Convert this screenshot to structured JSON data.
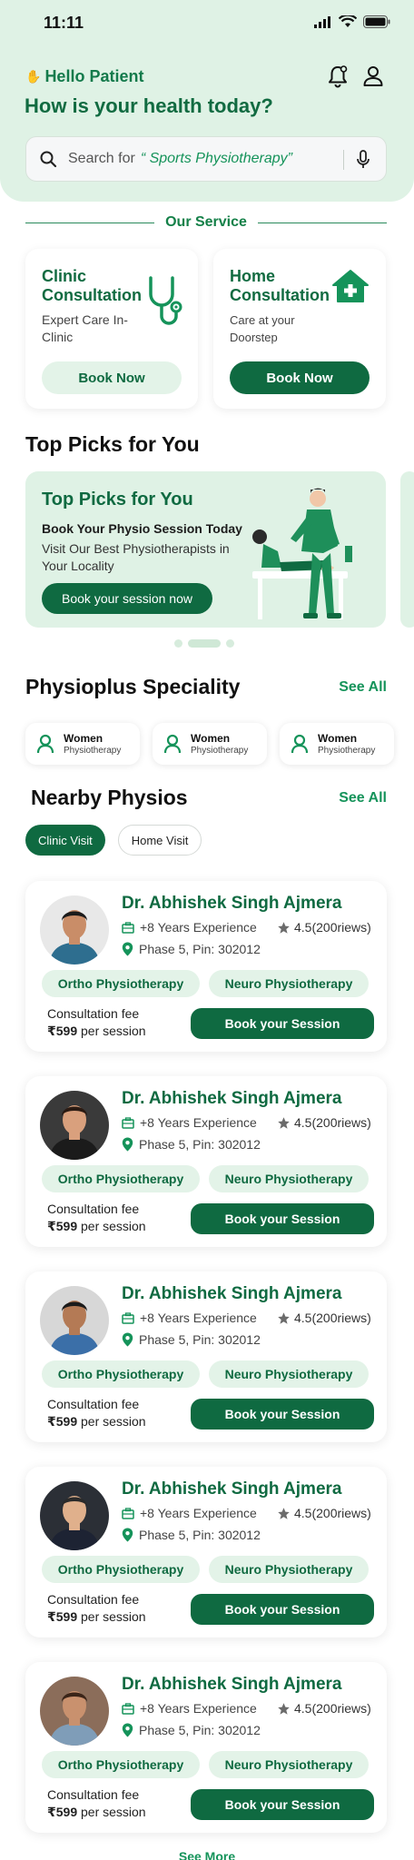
{
  "status_bar": {
    "time": "11:11"
  },
  "header": {
    "greeting": "Hello Patient",
    "subtitle": "How is your health today?",
    "search_prefix": "Search for",
    "search_highlight": "“ Sports Physiotherapy”"
  },
  "service": {
    "section_label": "Our Service",
    "cards": [
      {
        "title": "Clinic Consultation",
        "desc": "Expert Care In-Clinic",
        "button": "Book Now"
      },
      {
        "title": "Home Consultation",
        "desc": "Care at your Doorstep",
        "button": "Book Now"
      }
    ]
  },
  "top_picks": {
    "title": "Top Picks for You",
    "banner_title": "Top Picks for You",
    "banner_line1": "Book Your Physio Session Today",
    "banner_line2": "Visit Our Best Physiotherapists in Your Locality",
    "banner_button": "Book your session now",
    "carousel_active_index": 1
  },
  "speciality": {
    "title": "Physioplus Speciality",
    "see_all": "See All",
    "chips": [
      {
        "title": "Women",
        "sub": "Physiotherapy"
      },
      {
        "title": "Women",
        "sub": "Physiotherapy"
      },
      {
        "title": "Women",
        "sub": "Physiotherapy"
      }
    ]
  },
  "nearby": {
    "title": "Nearby Physios",
    "see_all": "See All",
    "tabs": [
      "Clinic Visit",
      "Home Visit"
    ],
    "active_tab": "Clinic Visit",
    "doctors": [
      {
        "name": "Dr. Abhishek Singh Ajmera",
        "experience": "+8 Years Experience",
        "rating": "4.5(200riews)",
        "location": "Phase 5, Pin: 302012",
        "tags": [
          "Ortho Physiotherapy",
          "Neuro Physiotherapy"
        ],
        "fee_label": "Consultation fee",
        "fee_amount": "₹599",
        "fee_suffix": "per session",
        "button": "Book your Session"
      },
      {
        "name": "Dr. Abhishek Singh Ajmera",
        "experience": "+8 Years Experience",
        "rating": "4.5(200riews)",
        "location": "Phase 5, Pin: 302012",
        "tags": [
          "Ortho Physiotherapy",
          "Neuro Physiotherapy"
        ],
        "fee_label": "Consultation fee",
        "fee_amount": "₹599",
        "fee_suffix": "per session",
        "button": "Book your Session"
      },
      {
        "name": "Dr. Abhishek Singh Ajmera",
        "experience": "+8 Years Experience",
        "rating": "4.5(200riews)",
        "location": "Phase 5, Pin: 302012",
        "tags": [
          "Ortho Physiotherapy",
          "Neuro Physiotherapy"
        ],
        "fee_label": "Consultation fee",
        "fee_amount": "₹599",
        "fee_suffix": "per session",
        "button": "Book your Session"
      },
      {
        "name": "Dr. Abhishek Singh Ajmera",
        "experience": "+8 Years Experience",
        "rating": "4.5(200riews)",
        "location": "Phase 5, Pin: 302012",
        "tags": [
          "Ortho Physiotherapy",
          "Neuro Physiotherapy"
        ],
        "fee_label": "Consultation fee",
        "fee_amount": "₹599",
        "fee_suffix": "per session",
        "button": "Book your Session"
      },
      {
        "name": "Dr. Abhishek Singh Ajmera",
        "experience": "+8 Years Experience",
        "rating": "4.5(200riews)",
        "location": "Phase 5, Pin: 302012",
        "tags": [
          "Ortho Physiotherapy",
          "Neuro Physiotherapy"
        ],
        "fee_label": "Consultation fee",
        "fee_amount": "₹599",
        "fee_suffix": "per session",
        "button": "Book your Session"
      }
    ],
    "see_more": "See More"
  },
  "colors": {
    "brand": "#0f6a41",
    "accent": "#15935a",
    "light_green": "#dff2e5",
    "chip_bg": "#e3f3e8"
  },
  "icons": [
    "wave-icon",
    "bell-icon",
    "profile-icon",
    "search-icon",
    "mic-icon",
    "stethoscope-icon",
    "home-plus-icon",
    "person-icon",
    "briefcase-icon",
    "star-icon",
    "location-pin-icon"
  ]
}
